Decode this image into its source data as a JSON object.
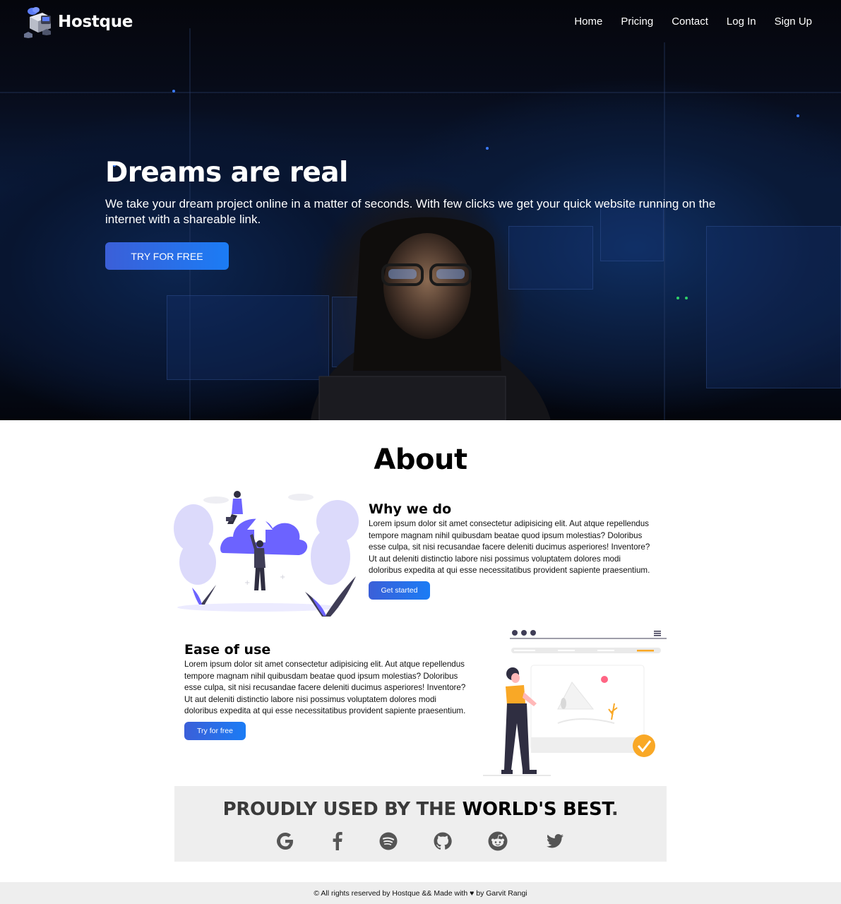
{
  "brand": {
    "name": "Hostque",
    "logo_icon": "server-cloud-icon"
  },
  "nav": {
    "items": [
      {
        "label": "Home"
      },
      {
        "label": "Pricing"
      },
      {
        "label": "Contact"
      },
      {
        "label": "Log In"
      },
      {
        "label": "Sign Up"
      }
    ]
  },
  "hero": {
    "title": "Dreams are real",
    "text": "We take your dream project online in a matter of seconds. With few clicks we get your quick website running on the internet with a shareable link.",
    "cta": "TRY FOR FREE"
  },
  "about": {
    "title": "About",
    "blocks": [
      {
        "title": "Why we do",
        "text": "Lorem ipsum dolor sit amet consectetur adipisicing elit. Aut atque repellendus tempore magnam nihil quibusdam beatae quod ipsum molestias? Doloribus esse culpa, sit nisi recusandae facere deleniti ducimus asperiores! Inventore? Ut aut deleniti distinctio labore nisi possimus voluptatem dolores modi doloribus expedita at qui esse necessitatibus provident sapiente praesentium.",
        "button": "Get started",
        "illustration": "cloud-upload-illustration"
      },
      {
        "title": "Ease of use",
        "text": "Lorem ipsum dolor sit amet consectetur adipisicing elit. Aut atque repellendus tempore magnam nihil quibusdam beatae quod ipsum molestias? Doloribus esse culpa, sit nisi recusandae facere deleniti ducimus asperiores! Inventore? Ut aut deleniti distinctio labore nisi possimus voluptatem dolores modi doloribus expedita at qui esse necessitatibus provident sapiente praesentium.",
        "button": "Try for free",
        "illustration": "website-builder-illustration"
      }
    ]
  },
  "brands": {
    "title_prefix": "PROUDLY USED BY THE",
    "title_strong": "WORLD'S BEST",
    "title_suffix": ".",
    "icons": [
      "google-icon",
      "facebook-icon",
      "spotify-icon",
      "github-icon",
      "reddit-icon",
      "twitter-icon"
    ]
  },
  "footer": {
    "text": "© All rights reserved by Hostque && Made with ♥ by Garvit Rangi"
  },
  "colors": {
    "accent_start": "#3b5fd8",
    "accent_end": "#1b7cf5",
    "illustration_purple": "#6c63ff",
    "illustration_yellow": "#f9a826",
    "section_gray": "#eeeeee"
  }
}
